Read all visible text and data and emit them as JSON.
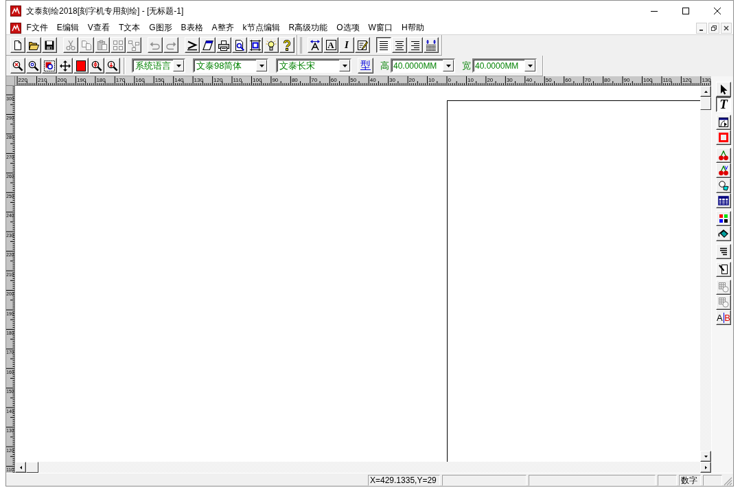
{
  "window": {
    "title": "文泰刻绘2018[刻字机专用刻绘] - [无标题-1]"
  },
  "menu_bar": {
    "items": [
      "F文件",
      "E编辑",
      "V查看",
      "T文本",
      "G图形",
      "B表格",
      "A整齐",
      "k节点编辑",
      "R高级功能",
      "O选项",
      "W窗口",
      "H帮助"
    ]
  },
  "standard_toolbar": {
    "groups": [
      {
        "buttons": [
          {
            "disabled": false,
            "pressed": false
          },
          {
            "disabled": false,
            "pressed": false
          },
          {
            "disabled": false,
            "pressed": false
          }
        ]
      },
      {
        "buttons": [
          {
            "disabled": true,
            "pressed": false
          },
          {
            "disabled": true,
            "pressed": false
          },
          {
            "disabled": true,
            "pressed": false
          },
          {
            "disabled": true,
            "pressed": false
          },
          {
            "disabled": true,
            "pressed": false
          }
        ]
      },
      {
        "buttons": [
          {
            "disabled": true,
            "pressed": false
          },
          {
            "disabled": true,
            "pressed": false
          }
        ]
      },
      {
        "buttons": [
          {
            "disabled": false,
            "pressed": false
          },
          {
            "disabled": false,
            "pressed": false
          },
          {
            "disabled": false,
            "pressed": false
          },
          {
            "disabled": false,
            "pressed": false
          },
          {
            "disabled": false,
            "pressed": false
          },
          {
            "disabled": false,
            "pressed": false
          },
          {
            "disabled": false,
            "pressed": false
          }
        ]
      },
      {
        "buttons": [
          {
            "disabled": false,
            "pressed": false
          },
          {
            "disabled": false,
            "pressed": false,
            "glyphs": [
              "A"
            ]
          },
          {
            "disabled": false,
            "pressed": false,
            "glyphs": [
              "I"
            ]
          },
          {
            "disabled": false,
            "pressed": false
          }
        ]
      },
      {
        "buttons": [
          {
            "disabled": false,
            "pressed": true
          },
          {
            "disabled": false,
            "pressed": false
          },
          {
            "disabled": false,
            "pressed": false
          },
          {
            "disabled": false,
            "pressed": false
          }
        ]
      }
    ]
  },
  "view_toolbar": {
    "buttons": [
      {
        "disabled": false,
        "pressed": false
      },
      {
        "disabled": false,
        "pressed": false
      },
      {
        "disabled": false,
        "pressed": false
      },
      {
        "disabled": false,
        "pressed": false
      },
      {
        "disabled": false,
        "pressed": false
      },
      {
        "disabled": false,
        "pressed": false
      },
      {
        "disabled": false,
        "pressed": false
      }
    ]
  },
  "format_toolbar": {
    "dropdowns": [
      "系统语言",
      "文泰98简体",
      "文泰长宋"
    ],
    "style_button": "型",
    "height": {
      "label": "高",
      "value": "40.0000MM"
    },
    "width": {
      "label": "宽",
      "value": "40.0000MM"
    }
  },
  "rulers": {
    "top_labels": [
      "220",
      "210",
      "200",
      "190",
      "180",
      "170",
      "160",
      "150",
      "140",
      "130",
      "120",
      "110",
      "100",
      "90",
      "80",
      "70",
      "60",
      "50",
      "40",
      "30",
      "20",
      "10",
      "0",
      "10",
      "20",
      "30",
      "40",
      "50",
      "60",
      "70",
      "80",
      "90",
      "100",
      "110",
      "120",
      "130"
    ],
    "left_labels": [
      "300",
      "290",
      "280",
      "270",
      "260",
      "250",
      "240",
      "230",
      "220",
      "210",
      "200",
      "190",
      "180",
      "170",
      "160",
      "150",
      "140",
      "130",
      "120",
      "110"
    ]
  },
  "tool_palette": {
    "groups": [
      {
        "buttons": [
          {
            "disabled": false,
            "pressed": false
          },
          {
            "disabled": false,
            "pressed": true,
            "glyphs": [
              "T"
            ]
          }
        ]
      },
      {
        "buttons": [
          {
            "disabled": false,
            "pressed": false
          },
          {
            "disabled": false,
            "pressed": false
          }
        ]
      },
      {
        "buttons": [
          {
            "disabled": false,
            "pressed": false
          },
          {
            "disabled": false,
            "pressed": false
          },
          {
            "disabled": false,
            "pressed": false
          },
          {
            "disabled": false,
            "pressed": false
          }
        ]
      },
      {
        "buttons": [
          {
            "disabled": false,
            "pressed": false
          },
          {
            "disabled": false,
            "pressed": false
          }
        ]
      },
      {
        "buttons": [
          {
            "disabled": false,
            "pressed": false
          }
        ]
      },
      {
        "buttons": [
          {
            "disabled": false,
            "pressed": false
          }
        ]
      },
      {
        "buttons": [
          {
            "disabled": true,
            "pressed": false
          },
          {
            "disabled": true,
            "pressed": false
          },
          {
            "disabled": false,
            "pressed": false,
            "glyphs": [
              "A",
              "B"
            ]
          }
        ]
      }
    ]
  },
  "status_bar": {
    "coordinates": "X=429.1335,Y=29",
    "num_lock": "数字"
  }
}
